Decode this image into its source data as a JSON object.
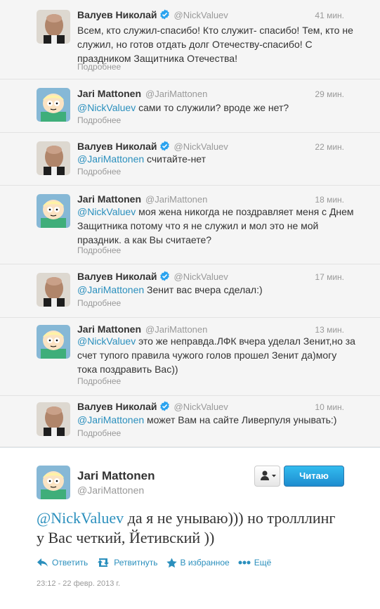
{
  "tweets": [
    {
      "name": "Валуев Николай",
      "handle": "@NickValuev",
      "time": "41 мин.",
      "mention": "",
      "text": "Всем, кто служил-спасибо! Кто служит- спасибо! Тем, кто не служил, но готов отдать долг Отечеству-спасибо! С праздником Защитника Отечества!",
      "more": "Подробнее"
    },
    {
      "name": "Jari Mattonen",
      "handle": "@JariMattonen",
      "time": "29 мин.",
      "mention": "@NickValuev",
      "text": " сами то служили? вроде же нет?",
      "more": "Подробнее"
    },
    {
      "name": "Валуев Николай",
      "handle": "@NickValuev",
      "time": "22 мин.",
      "mention": "@JariMattonen",
      "text": " считайте-нет",
      "more": "Подробнее"
    },
    {
      "name": "Jari Mattonen",
      "handle": "@JariMattonen",
      "time": "18 мин.",
      "mention": "@NickValuev",
      "text": " моя жена никогда не поздравляет меня с Днем Защитника потому что я не служил и мол это не мой праздник. а как Вы считаете?",
      "more": "Подробнее"
    },
    {
      "name": "Валуев Николай",
      "handle": "@NickValuev",
      "time": "17 мин.",
      "mention": "@JariMattonen",
      "text": " Зенит вас вчера сделал:)",
      "more": "Подробнее"
    },
    {
      "name": "Jari Mattonen",
      "handle": "@JariMattonen",
      "time": "13 мин.",
      "mention": "@NickValuev",
      "text": " это же неправда.ЛФК вчера уделал Зенит,но за счет тупого правила чужого голов прошел Зенит да)могу тока поздравить Вас))",
      "more": "Подробнее"
    },
    {
      "name": "Валуев Николай",
      "handle": "@NickValuev",
      "time": "10 мин.",
      "mention": "@JariMattonen",
      "text": " может Вам на сайте Ливерпуля унывать:)",
      "more": "Подробнее"
    }
  ],
  "main": {
    "name": "Jari Mattonen",
    "handle": "@JariMattonen",
    "follow_label": "Читаю",
    "mention": "@NickValuev",
    "text": " да я не унываю))) но тролллинг у Вас четкий, Йетивский ))",
    "actions": {
      "reply": "Ответить",
      "retweet": "Ретвитнуть",
      "favorite": "В избранное",
      "more": "Ещё"
    },
    "timestamp": "23:12 - 22 февр. 2013 г."
  },
  "colors": {
    "link": "#2a8fbd",
    "verified": "#2aa3ef",
    "follow_button": "#1d8ccf"
  },
  "icons": {
    "verified": "verified-badge-icon",
    "user_dropdown": "user-dropdown-icon",
    "reply": "reply-icon",
    "retweet": "retweet-icon",
    "favorite": "star-icon",
    "more": "more-dots-icon"
  }
}
